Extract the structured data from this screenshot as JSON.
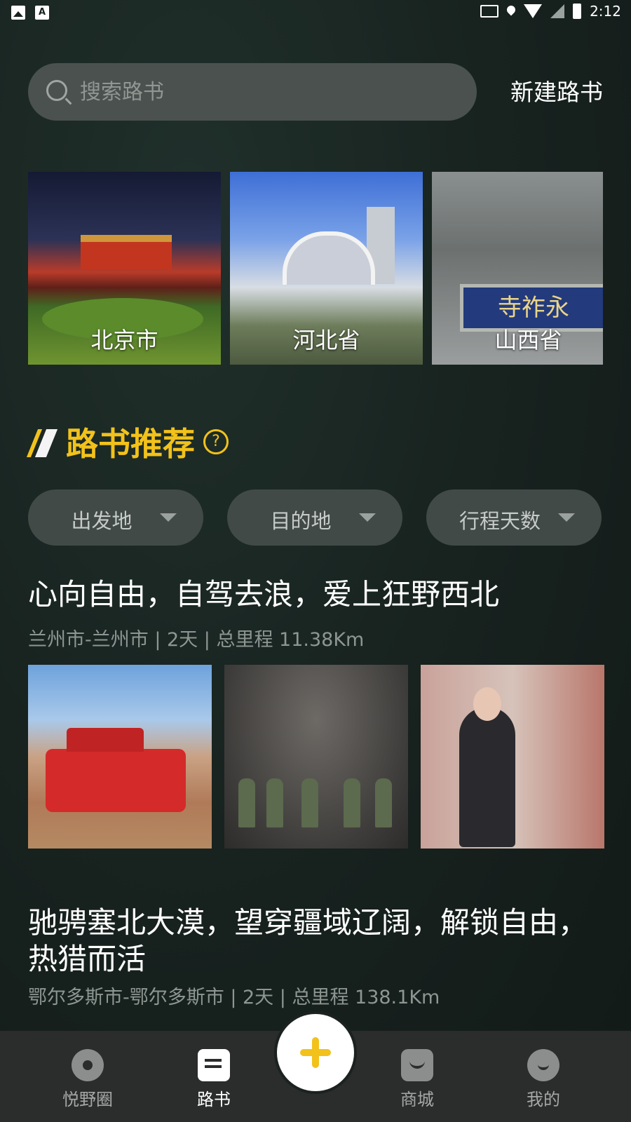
{
  "status_bar": {
    "time": "2:12"
  },
  "search": {
    "placeholder": "搜索路书",
    "new_button": "新建路书"
  },
  "regions": [
    {
      "name": "北京市"
    },
    {
      "name": "河北省"
    },
    {
      "name": "山西省"
    }
  ],
  "region_3_plaque": "寺祚永",
  "section": {
    "title": "路书推荐",
    "help_icon": "?"
  },
  "filters": [
    {
      "label": "出发地"
    },
    {
      "label": "目的地"
    },
    {
      "label": "行程天数"
    }
  ],
  "routes": [
    {
      "title": "心向自由，自驾去浪，爱上狂野西北",
      "subtitle": "兰州市-兰州市 | 2天 | 总里程 11.38Km"
    },
    {
      "title": "驰骋塞北大漠，望穿疆域辽阔，解锁自由，热猎而活",
      "subtitle": "鄂尔多斯市-鄂尔多斯市 | 2天 | 总里程 138.1Km"
    }
  ],
  "bottom_nav": [
    {
      "label": "悦野圈",
      "icon": "reel-icon"
    },
    {
      "label": "路书",
      "icon": "document-icon"
    },
    {
      "label": "商城",
      "icon": "shop-icon"
    },
    {
      "label": "我的",
      "icon": "profile-icon"
    }
  ],
  "colors": {
    "accent": "#f2c21b",
    "background": "#17211e"
  }
}
